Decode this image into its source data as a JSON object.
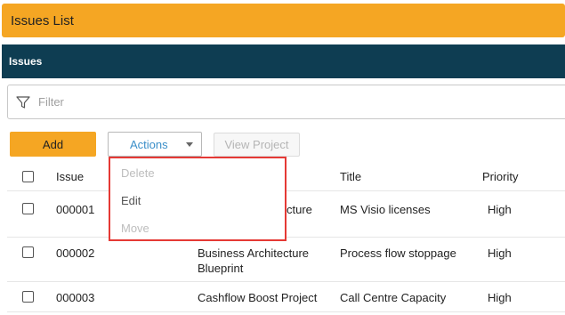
{
  "page": {
    "title": "Issues List"
  },
  "section": {
    "title": "Issues"
  },
  "filter": {
    "placeholder": "Filter"
  },
  "toolbar": {
    "add_label": "Add",
    "actions_label": "Actions",
    "view_project_label": "View Project"
  },
  "actions_menu": {
    "items": [
      {
        "label": "Delete",
        "enabled": false
      },
      {
        "label": "Edit",
        "enabled": true
      },
      {
        "label": "Move",
        "enabled": false
      }
    ]
  },
  "table": {
    "columns": [
      "Issue",
      "Title",
      "Priority"
    ],
    "rows": [
      {
        "issue": "000001",
        "project": "Business Architecture",
        "project_visible_tail": "cture",
        "title": "MS Visio licenses",
        "priority": "High"
      },
      {
        "issue": "000002",
        "project_line1": "Business Architecture",
        "project_line2": "Blueprint",
        "title": "Process flow stoppage",
        "priority": "High"
      },
      {
        "issue": "000003",
        "project": "Cashflow Boost Project",
        "title": "Call Centre Capacity",
        "priority": "High"
      }
    ]
  },
  "colors": {
    "accent": "#f5a623",
    "header_bar": "#0e3d52",
    "link": "#3b8fc9",
    "highlight_border": "#e53935"
  }
}
